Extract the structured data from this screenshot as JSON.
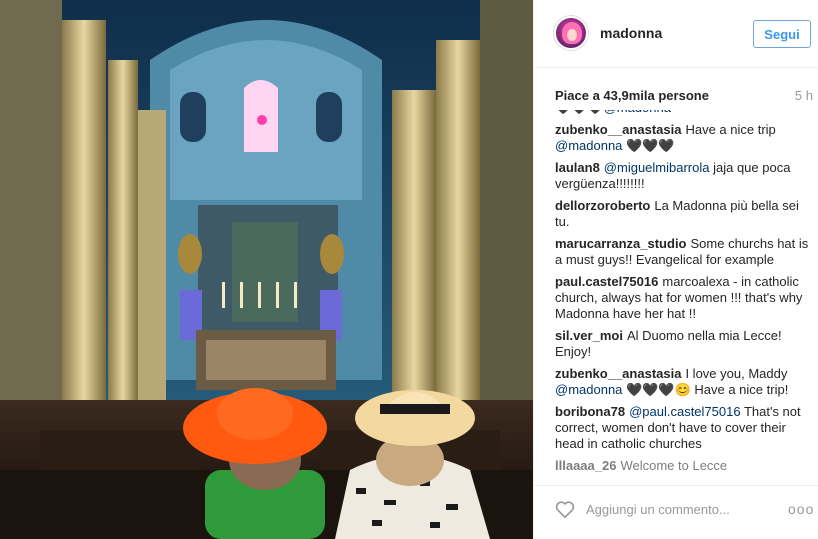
{
  "post": {
    "username": "madonna",
    "follow_label": "Segui",
    "likes_text": "Piace a 43,9mila persone",
    "time_ago": "5 h"
  },
  "comments": [
    {
      "author": "",
      "mention": "@madonna",
      "text": " 🖤🖤🖤",
      "cut": true
    },
    {
      "author": "zubenko__anastasia",
      "text": "Have a nice trip ",
      "mention": "@madonna",
      "text2": " 🖤🖤🖤"
    },
    {
      "author": "laulan8",
      "mention": "@miguelmibarrola",
      "text2": " jaja que poca vergüenza!!!!!!!!"
    },
    {
      "author": "dellorzoroberto",
      "text": "La Madonna più bella sei tu."
    },
    {
      "author": "marucarranza_studio",
      "text": "Some churchs hat is a must guys!! Evangelical for example"
    },
    {
      "author": "paul.castel75016",
      "text": "marcoalexa - in catholic church, always hat for women !!! that's why Madonna have her hat !!"
    },
    {
      "author": "sil.ver_moi",
      "text": "Al Duomo nella mia Lecce! Enjoy!"
    },
    {
      "author": "zubenko__anastasia",
      "text": "I love you, Maddy ",
      "mention": "@madonna",
      "text2": " 🖤🖤🖤😊 Have a nice trip!"
    },
    {
      "author": "boribona78",
      "mention": "@paul.castel75016",
      "text2": " That's not correct, women don't have to cover their head in catholic churches"
    },
    {
      "author": "lllaaaa_26",
      "text": "Welcome to Lecce",
      "fade": true
    }
  ],
  "footer": {
    "comment_placeholder": "Aggiungi un commento...",
    "more_label": "ooo"
  },
  "colors": {
    "follow_blue": "#3897f0",
    "mention_blue": "#003569",
    "orange_hat": "#ff5a10",
    "straw_hat": "#f3d9a0"
  },
  "icons": {
    "like": "heart-outline-icon",
    "options": "more-options-icon"
  }
}
